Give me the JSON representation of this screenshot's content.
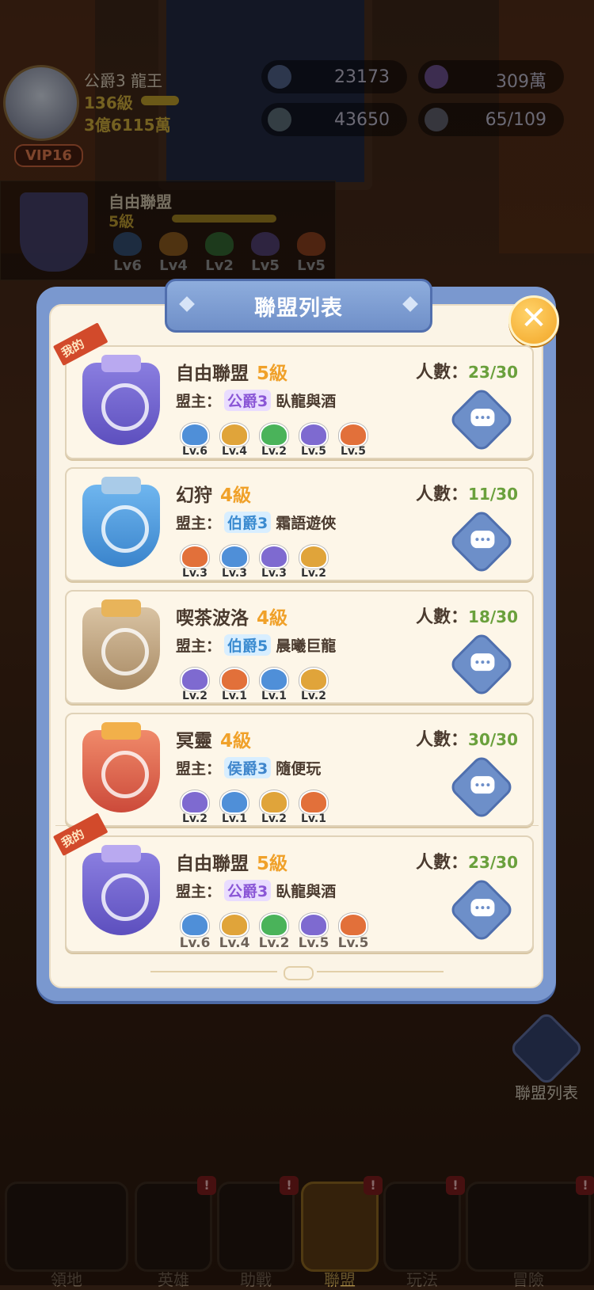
{
  "player": {
    "name": "公爵3 龍王",
    "level": "136級",
    "power": "3億6115萬",
    "vip": "VIP16"
  },
  "resources": [
    {
      "icon": "star-gem-icon",
      "value": "23173"
    },
    {
      "icon": "swirl-orb-icon",
      "value": "309萬"
    },
    {
      "icon": "crystal-gem-icon",
      "value": "43650"
    },
    {
      "icon": "members-icon",
      "value": "65/109"
    }
  ],
  "current_guild": {
    "name": "自由聯盟",
    "level": "5級",
    "badges": [
      "Lv6",
      "Lv4",
      "Lv2",
      "Lv5",
      "Lv5"
    ]
  },
  "side": {
    "guild_list_label": "聯盟列表"
  },
  "panel": {
    "title": "聯盟列表",
    "leader_label": "盟主：",
    "members_label": "人數：",
    "mine_tag": "我的",
    "guilds": [
      {
        "name": "自由聯盟",
        "level": "5級",
        "rank": "公爵3",
        "leader": "臥龍與酒",
        "members": "23/30",
        "badges": [
          "Lv.6",
          "Lv.4",
          "Lv.2",
          "Lv.5",
          "Lv.5"
        ],
        "mine": true
      },
      {
        "name": "幻狩",
        "level": "4級",
        "rank": "伯爵3",
        "leader": "霜語遊俠",
        "members": "11/30",
        "badges": [
          "Lv.3",
          "Lv.3",
          "Lv.3",
          "Lv.2"
        ],
        "mine": false
      },
      {
        "name": "喫茶波洛",
        "level": "4級",
        "rank": "伯爵5",
        "leader": "晨曦巨龍",
        "members": "18/30",
        "badges": [
          "Lv.2",
          "Lv.1",
          "Lv.1",
          "Lv.2"
        ],
        "mine": false
      },
      {
        "name": "冥靈",
        "level": "4級",
        "rank": "侯爵3",
        "leader": "隨便玩",
        "members": "30/30",
        "badges": [
          "Lv.2",
          "Lv.1",
          "Lv.2",
          "Lv.1"
        ],
        "mine": false
      },
      {
        "name": "自由聯盟",
        "level": "5級",
        "rank": "公爵3",
        "leader": "臥龍與酒",
        "members": "23/30",
        "badges": [
          "Lv.6",
          "Lv.4",
          "Lv.2",
          "Lv.5",
          "Lv.5"
        ],
        "mine": true
      }
    ]
  },
  "nav": [
    {
      "label": "領地",
      "badge": ""
    },
    {
      "label": "英雄",
      "badge": "!"
    },
    {
      "label": "助戰",
      "badge": "!"
    },
    {
      "label": "聯盟",
      "badge": "!"
    },
    {
      "label": "玩法",
      "badge": "!"
    },
    {
      "label": "冒險",
      "badge": "!"
    }
  ],
  "colors": {
    "panel_blue": "#7a98cf",
    "level_orange": "#f0a12a",
    "members_green": "#6aa03c",
    "close_gold": "#f2a526"
  }
}
